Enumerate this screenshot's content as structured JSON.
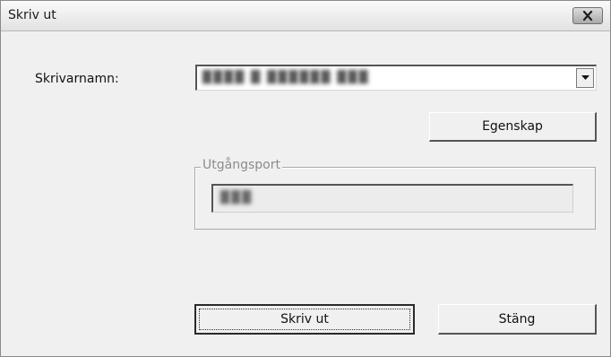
{
  "window": {
    "title": "Skriv ut",
    "close_icon": "close-x-icon"
  },
  "printer": {
    "label": "Skrivarnamn:",
    "selected_value": "████ █ ██████ ███",
    "dropdown_icon": "chevron-down-icon"
  },
  "buttons": {
    "properties": "Egenskap",
    "print": "Skriv ut",
    "close": "Stäng"
  },
  "output_port": {
    "legend": "Utgångsport",
    "value": "███"
  }
}
